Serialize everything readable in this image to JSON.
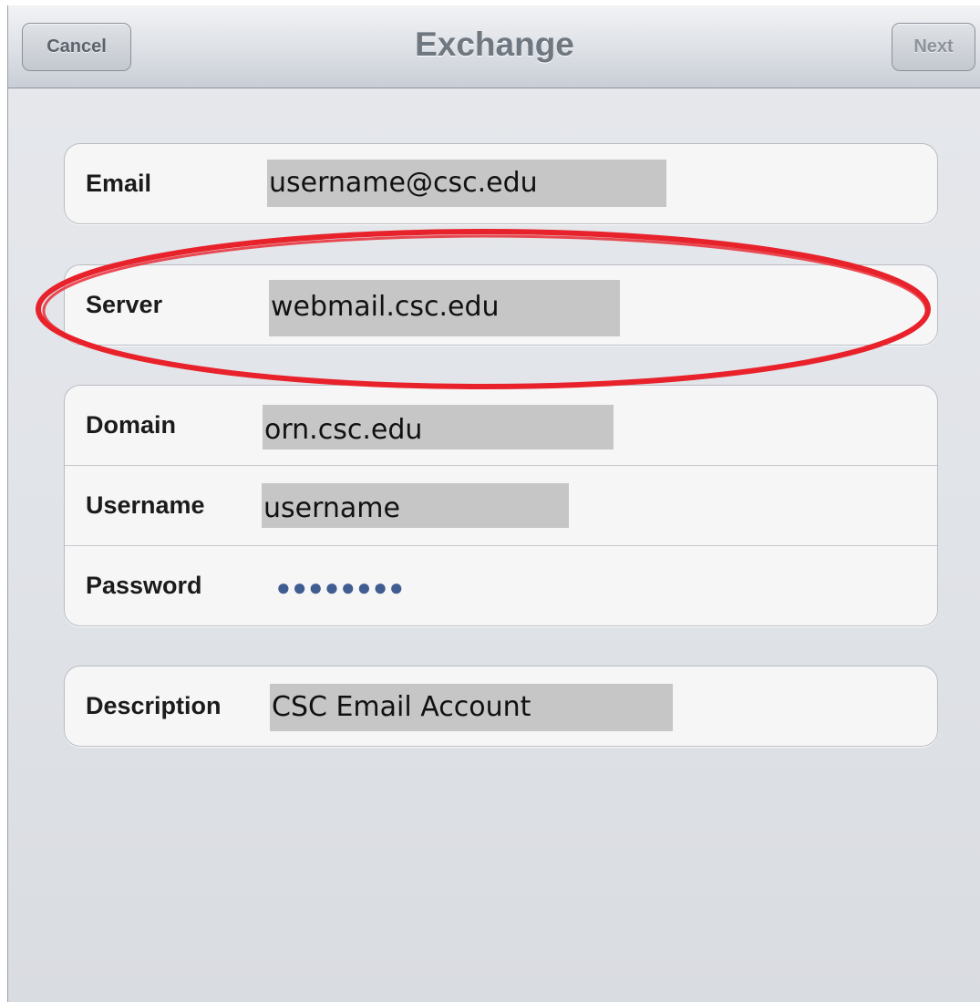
{
  "navbar": {
    "title": "Exchange",
    "cancel_label": "Cancel",
    "next_label": "Next"
  },
  "fields": {
    "email": {
      "label": "Email",
      "value": "username@csc.edu"
    },
    "server": {
      "label": "Server",
      "value": "webmail.csc.edu"
    },
    "domain": {
      "label": "Domain",
      "value": "orn.csc.edu"
    },
    "username": {
      "label": "Username",
      "value": "username"
    },
    "password": {
      "label": "Password",
      "value": "●●●●●●●●"
    },
    "description": {
      "label": "Description",
      "value": "CSC Email Account"
    }
  },
  "colors": {
    "annotation_circle": "#e8222b",
    "password_dots": "#3f5d91",
    "value_highlight": "#c6c6c6"
  }
}
